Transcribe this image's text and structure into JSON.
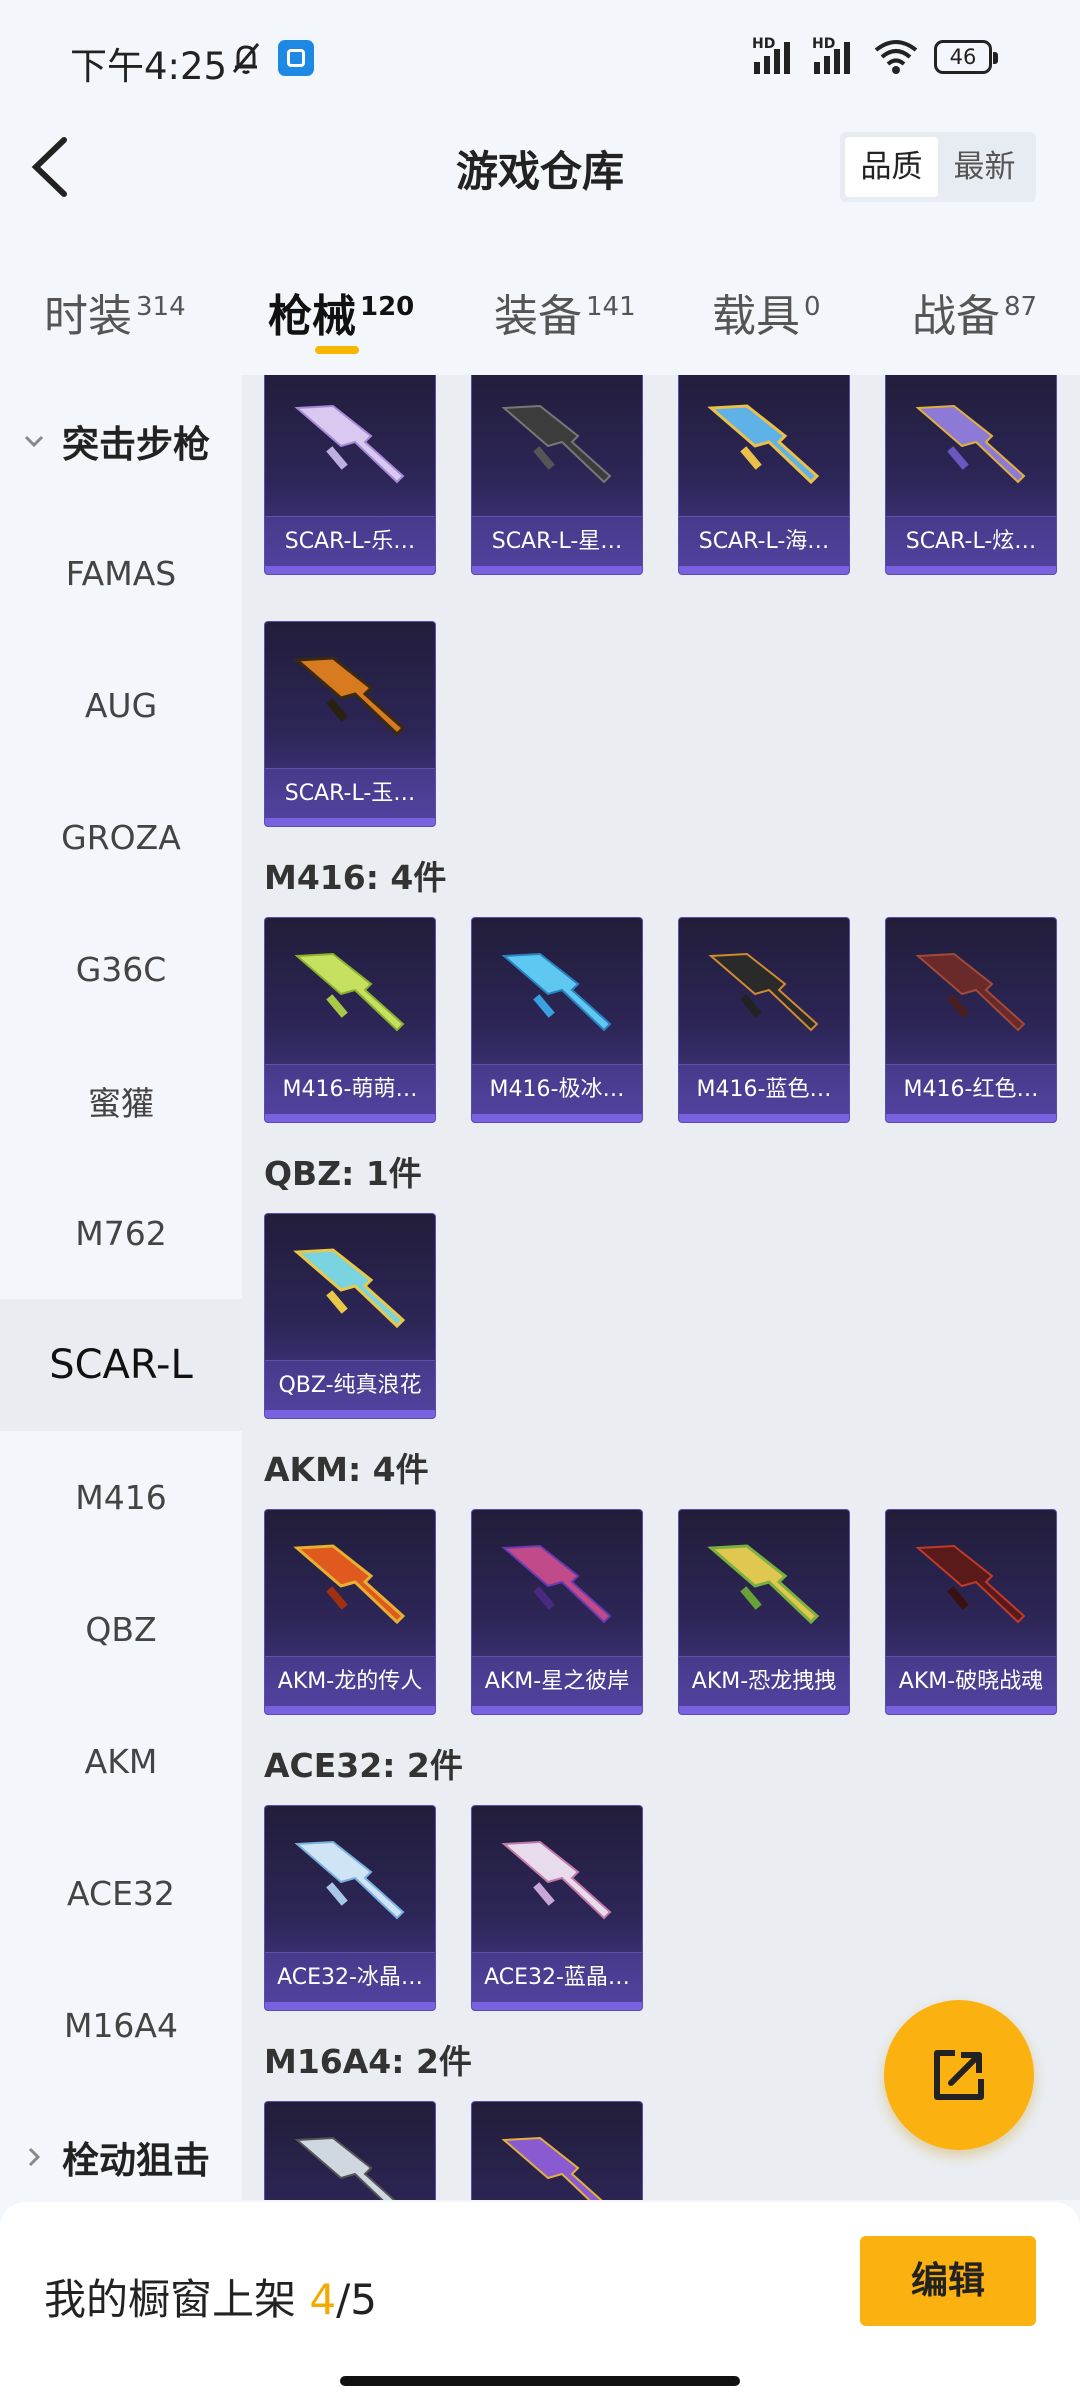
{
  "status_bar": {
    "time": "下午4:25",
    "battery": "46",
    "hd": "HD"
  },
  "header": {
    "title": "游戏仓库",
    "sort_options": [
      "品质",
      "最新"
    ]
  },
  "tabs": [
    {
      "label": "时装",
      "count": "314"
    },
    {
      "label": "枪械",
      "count": "120"
    },
    {
      "label": "装备",
      "count": "141"
    },
    {
      "label": "载具",
      "count": "0"
    },
    {
      "label": "战备",
      "count": "87"
    }
  ],
  "sidebar": {
    "category_expanded": "突击步枪",
    "items": [
      "FAMAS",
      "AUG",
      "GROZA",
      "G36C",
      "蜜獾",
      "M762",
      "SCAR-L",
      "M416",
      "QBZ",
      "AKM",
      "ACE32",
      "M16A4"
    ],
    "category_collapsed": "栓动狙击"
  },
  "content": {
    "groups": [
      {
        "label": "",
        "items": [
          "SCAR-L-乐…",
          "SCAR-L-星…",
          "SCAR-L-海…",
          "SCAR-L-炫…",
          "SCAR-L-玉…"
        ]
      },
      {
        "label": "M416: 4件",
        "items": [
          "M416-萌萌…",
          "M416-极冰…",
          "M416-蓝色…",
          "M416-红色…"
        ]
      },
      {
        "label": "QBZ: 1件",
        "items": [
          "QBZ-纯真浪花"
        ]
      },
      {
        "label": "AKM: 4件",
        "items": [
          "AKM-龙的传人",
          "AKM-星之彼岸",
          "AKM-恐龙拽拽",
          "AKM-破晓战魂"
        ]
      },
      {
        "label": "ACE32: 2件",
        "items": [
          "ACE32-冰晶…",
          "ACE32-蓝晶…"
        ]
      },
      {
        "label": "M16A4: 2件",
        "items": [
          "",
          ""
        ]
      }
    ]
  },
  "bottom": {
    "label": "我的橱窗上架",
    "count_current": "4",
    "count_total": "/5",
    "edit_button": "编辑"
  }
}
